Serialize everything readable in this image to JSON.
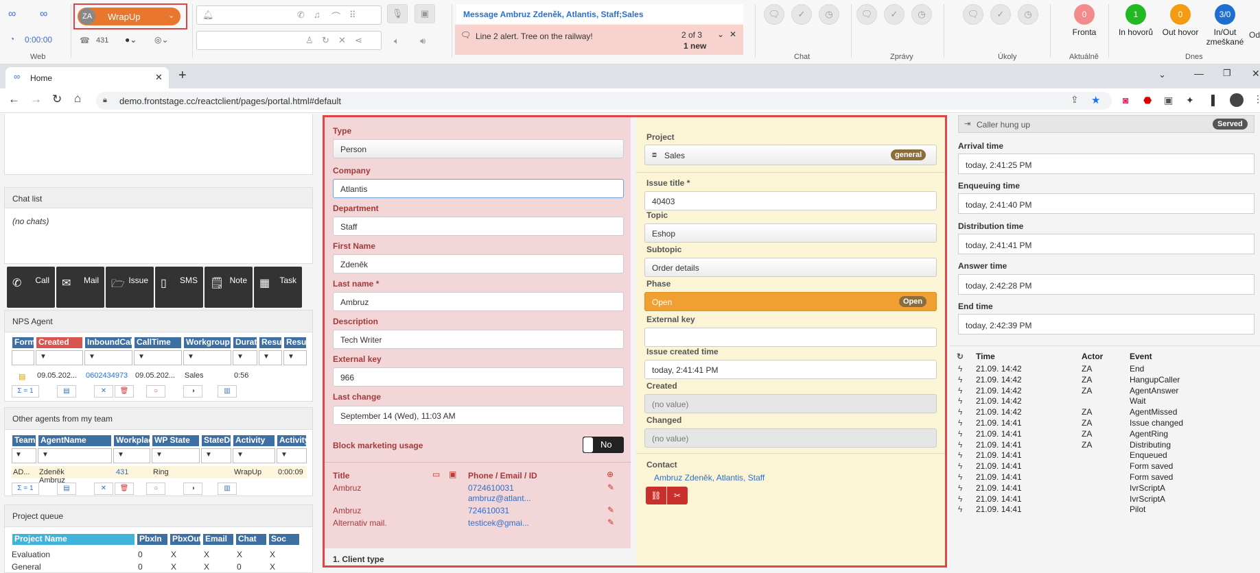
{
  "top": {
    "web_label": "Web",
    "timer": "0:00:00",
    "avatar_initials": "ZA",
    "status": "WrapUp",
    "extension": "431",
    "message_title": "Message Ambruz Zdeněk, Atlantis, Staff;Sales",
    "alert_text": "Line 2 alert. Tree on the railway!",
    "alert_count": "2 of 3",
    "alert_new": "1 new",
    "groups": {
      "chat": "Chat",
      "zpravy": "Zprávy",
      "ukoly": "Úkoly",
      "aktualne": "Aktuálně",
      "dnes": "Dnes"
    },
    "stats": [
      {
        "value": "0",
        "label": "Fronta",
        "color": "#f28b8b"
      },
      {
        "value": "1",
        "label": "In hovorů",
        "color": "#22b922"
      },
      {
        "value": "0",
        "label": "Out hovor",
        "color": "#f39c12"
      },
      {
        "value": "3/0",
        "label": "In/Out zmeškané",
        "color": "#1f6fd1"
      }
    ],
    "stat_extra": "Od"
  },
  "browser": {
    "tab_title": "Home",
    "url": "demo.frontstage.cc/reactclient/pages/portal.html#default"
  },
  "left": {
    "chat_list_title": "Chat list",
    "no_chats": "(no chats)",
    "actions": [
      "Call",
      "Mail",
      "Issue",
      "SMS",
      "Note",
      "Task"
    ],
    "nps_title": "NPS Agent",
    "nps_headers": [
      "Form",
      "Created",
      "InboundCall",
      "CallTime",
      "Workgroup",
      "Durati",
      "Result",
      "Result"
    ],
    "nps_row": [
      "",
      "09.05.202...",
      "0602434973",
      "09.05.202...",
      "Sales",
      "0:56",
      "",
      ""
    ],
    "nps_sum": "Σ = 1",
    "agents_title": "Other agents from my team",
    "agents_headers": [
      "TeamN",
      "AgentName",
      "Workplace",
      "WP State",
      "StateDu",
      "Activity",
      "ActivityD"
    ],
    "agents_row": [
      "AD...",
      "Zdeněk Ambruz",
      "431",
      "Ring",
      "",
      "WrapUp",
      "0:00:09"
    ],
    "agents_sum": "Σ = 1",
    "queue_title": "Project queue",
    "queue_headers": [
      "Project Name",
      "PbxIn",
      "PbxOut",
      "Email",
      "Chat",
      "Soc"
    ],
    "queue_rows": [
      [
        "Evaluation",
        "0",
        "X",
        "X",
        "X",
        "X"
      ],
      [
        "General",
        "0",
        "X",
        "X",
        "0",
        "X"
      ]
    ]
  },
  "form": {
    "type_label": "Type",
    "type_value": "Person",
    "company_label": "Company",
    "company_value": "Atlantis",
    "department_label": "Department",
    "department_value": "Staff",
    "firstname_label": "First Name",
    "firstname_value": "Zdeněk",
    "lastname_label": "Last name *",
    "lastname_value": "Ambruz",
    "description_label": "Description",
    "description_value": "Tech Writer",
    "extkey_label": "External key",
    "extkey_value": "966",
    "lastchange_label": "Last change",
    "lastchange_value": "September 14 (Wed), 11:03 AM",
    "block_label": "Block marketing usage",
    "block_toggle": "No",
    "contacts_title_header": "Title",
    "contacts_phone_header": "Phone / Email / ID",
    "contacts": [
      {
        "title": "Ambruz",
        "value": "0724610031"
      },
      {
        "title": "",
        "value": "ambruz@atlant..."
      },
      {
        "title": "Ambruz",
        "value": "724610031"
      },
      {
        "title": "Alternativ mail.",
        "value": "testicek@gmai..."
      }
    ],
    "client_type": "1. Client type"
  },
  "issue": {
    "project_label": "Project",
    "project_value": "Sales",
    "project_badge": "general",
    "title_label": "Issue title *",
    "title_value": "40403",
    "topic_label": "Topic",
    "topic_value": "Eshop",
    "subtopic_label": "Subtopic",
    "subtopic_value": "Order details",
    "phase_label": "Phase",
    "phase_value": "Open",
    "phase_badge": "Open",
    "extkey_label": "External key",
    "extkey_value": "",
    "created_time_label": "Issue created time",
    "created_time_value": "today, 2:41:41 PM",
    "created_label": "Created",
    "created_value": "(no value)",
    "changed_label": "Changed",
    "changed_value": "(no value)",
    "contact_label": "Contact",
    "contact_value": "Ambruz Zdeněk, Atlantis, Staff"
  },
  "call": {
    "status_text": "Caller hung up",
    "status_badge": "Served",
    "arrival_label": "Arrival time",
    "arrival_value": "today, 2:41:25 PM",
    "enqueue_label": "Enqueuing time",
    "enqueue_value": "today, 2:41:40 PM",
    "distribution_label": "Distribution time",
    "distribution_value": "today, 2:41:41 PM",
    "answer_label": "Answer time",
    "answer_value": "today, 2:42:28 PM",
    "end_label": "End time",
    "end_value": "today, 2:42:39 PM",
    "history_headers": [
      "Time",
      "Actor",
      "Event"
    ],
    "history": [
      [
        "21.09. 14:42",
        "ZA",
        "End"
      ],
      [
        "21.09. 14:42",
        "ZA",
        "HangupCaller"
      ],
      [
        "21.09. 14:42",
        "ZA",
        "AgentAnswer"
      ],
      [
        "21.09. 14:42",
        "",
        "Wait"
      ],
      [
        "21.09. 14:42",
        "ZA",
        "AgentMissed"
      ],
      [
        "21.09. 14:41",
        "ZA",
        "Issue changed"
      ],
      [
        "21.09. 14:41",
        "ZA",
        "AgentRing"
      ],
      [
        "21.09. 14:41",
        "ZA",
        "Distributing"
      ],
      [
        "21.09. 14:41",
        "",
        "Enqueued"
      ],
      [
        "21.09. 14:41",
        "",
        "Form saved"
      ],
      [
        "21.09. 14:41",
        "",
        "Form saved"
      ],
      [
        "21.09. 14:41",
        "",
        "IvrScriptA"
      ],
      [
        "21.09. 14:41",
        "",
        "IvrScriptA"
      ],
      [
        "21.09. 14:41",
        "",
        "Pilot"
      ]
    ]
  }
}
